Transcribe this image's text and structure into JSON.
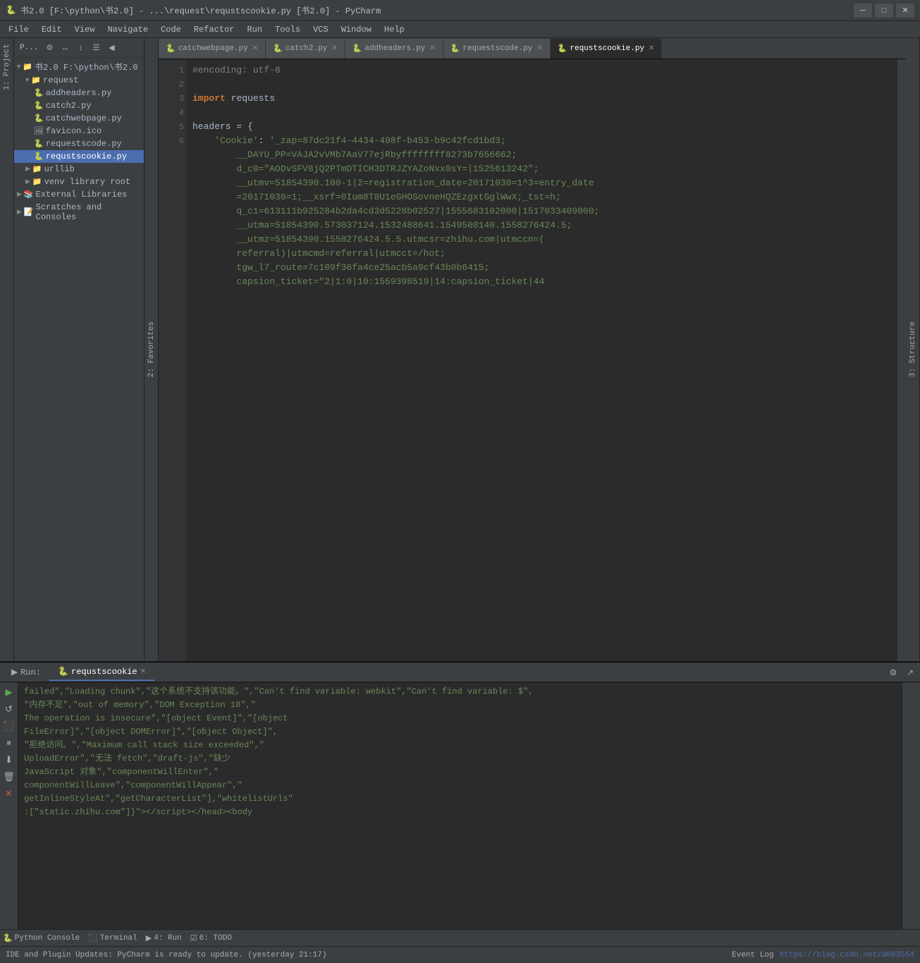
{
  "titlebar": {
    "title": "书2.0 [F:\\python\\书2.0] - ...\\request\\requstscookie.py [书2.0] - PyCharm",
    "icon": "🐍",
    "minimize": "─",
    "maximize": "□",
    "close": "✕"
  },
  "menubar": {
    "items": [
      "File",
      "Edit",
      "View",
      "Navigate",
      "Code",
      "Refactor",
      "Run",
      "Tools",
      "VCS",
      "Window",
      "Help"
    ]
  },
  "sidebar": {
    "title": "Project",
    "toolbar_buttons": [
      "P...",
      "⚙",
      "↔",
      "↕",
      "☰",
      "◀"
    ],
    "tree": [
      {
        "label": "书2.0 F:\\python\\书2.0",
        "level": 0,
        "icon": "📁",
        "expanded": true
      },
      {
        "label": "request",
        "level": 1,
        "icon": "📁",
        "expanded": true
      },
      {
        "label": "addheaders.py",
        "level": 2,
        "icon": "🐍"
      },
      {
        "label": "catch2.py",
        "level": 2,
        "icon": "🐍"
      },
      {
        "label": "catchwebpage.py",
        "level": 2,
        "icon": "🐍"
      },
      {
        "label": "favicon.ico",
        "level": 2,
        "icon": "🖼"
      },
      {
        "label": "requestscode.py",
        "level": 2,
        "icon": "🐍"
      },
      {
        "label": "requstscookie.py",
        "level": 2,
        "icon": "🐍",
        "selected": true
      },
      {
        "label": "urllib",
        "level": 1,
        "icon": "📁"
      },
      {
        "label": "venv library root",
        "level": 1,
        "icon": "📁"
      },
      {
        "label": "External Libraries",
        "level": 0,
        "icon": "📚"
      },
      {
        "label": "Scratches and Consoles",
        "level": 0,
        "icon": "📝"
      }
    ]
  },
  "tabs": [
    {
      "label": "catchwebpage.py",
      "icon": "🐍",
      "active": false
    },
    {
      "label": "catch2.py",
      "icon": "🐍",
      "active": false
    },
    {
      "label": "addheaders.py",
      "icon": "🐍",
      "active": false
    },
    {
      "label": "requestscode.py",
      "icon": "🐍",
      "active": false
    },
    {
      "label": "requstscookie.py",
      "icon": "🐍",
      "active": true
    }
  ],
  "code": {
    "lines": [
      {
        "num": 1,
        "content": "#encoding: utf-8",
        "type": "comment"
      },
      {
        "num": 2,
        "content": "",
        "type": "blank"
      },
      {
        "num": 3,
        "content": "import requests",
        "type": "import"
      },
      {
        "num": 4,
        "content": "",
        "type": "blank"
      },
      {
        "num": 5,
        "content": "headers = {",
        "type": "code"
      },
      {
        "num": 6,
        "content": "    'Cookie': '_zap=87dc21f4-4434-498f-b453-b9c42fcd1bd3;__DAYU_PP=VAJA2vVMb7AaV77ejRbyffffffff8273b7656662;d_c0=\"AODvSFV8jQ2PTmDTICH3DTRJZYAZoNxx0sY=|1525613242\";__utmv=51854390.100-1|2=registration_date=20171030=1^3=entry_date=20171030=1;__xsrf=0Ium8T8U1eGHOSovneHQZEzgxtGglWwX;_tst=h;q_c1=613111b925284b2da4cd3d5228b02527|1555683102000|1517033409000;__utma=51854390.573037124.1532488641.1549508140.1558276424.5;__utmz=51854390.1558276424.5.5.utmcsr=zhihu.com|utmccn=(referral)|utmcmd=referral|utmcct=/hot;tgw_l7_route=7c109f36fa4ce25acb5a9cf43b0b6415;capsion_ticket=\"2|1:0|10:1559398519|14:capsion_ticket|44",
        "type": "string_continue"
      }
    ]
  },
  "run_panel": {
    "tab_label": "requstscookie",
    "output": "failed&quot;,&quot;Loading chunk&quot;,&quot;这个系统不支持该功能。&quot;,&quot;Can&#x27;t find variable: webkit&quot;,&quot;Can&#x27;t find variable: $&quot;,&quot;内存不足&quot;,&quot;out of memory&quot;,&quot;DOM Exception 18&quot;,&quot;The operation is insecure&quot;,&quot;[object Event]&quot;,&quot;[object FileError]&quot;,&quot;[object DOMError]&quot;,&quot;[object Object]&quot;,&quot;拒绝访问。&quot;,&quot;Maximum call stack size exceeded&quot;,&quot;UploadError&quot;,&quot;无法 fetch&quot;,&quot;draft-js&quot;,&quot;缺少JavaScript 对象&quot;,&quot;componentWillEnter&quot;,&quot;componentWillLeave&quot;,&quot;componentWillAppear&quot;,&quot;getInlineStyleAt&quot;,&quot;getCharacterList&quot;],&quot;whitelistUrls&quot;:[&quot;static.zhihu.com&quot;]}\">&lt;/script&gt;&lt;/head&gt;&lt;body"
  },
  "bottom_tabs": [
    "Run",
    "Terminal",
    "4: Run",
    "6: TODO"
  ],
  "statusbar": {
    "left": "IDE and Plugin Updates: PyCharm is ready to update. (yesterday 21:17)",
    "right": "https://blog.csdn.net/d663554"
  },
  "bottom_strip": [
    {
      "icon": "🐍",
      "label": "Python Console"
    },
    {
      "icon": "⬛",
      "label": "Terminal"
    },
    {
      "icon": "▶",
      "label": "4: Run"
    },
    {
      "icon": "☑",
      "label": "6: TODO"
    }
  ],
  "left_tabs": [
    {
      "label": "1: Project"
    },
    {
      "label": "2: Favorites"
    },
    {
      "label": "3: Structure"
    }
  ]
}
